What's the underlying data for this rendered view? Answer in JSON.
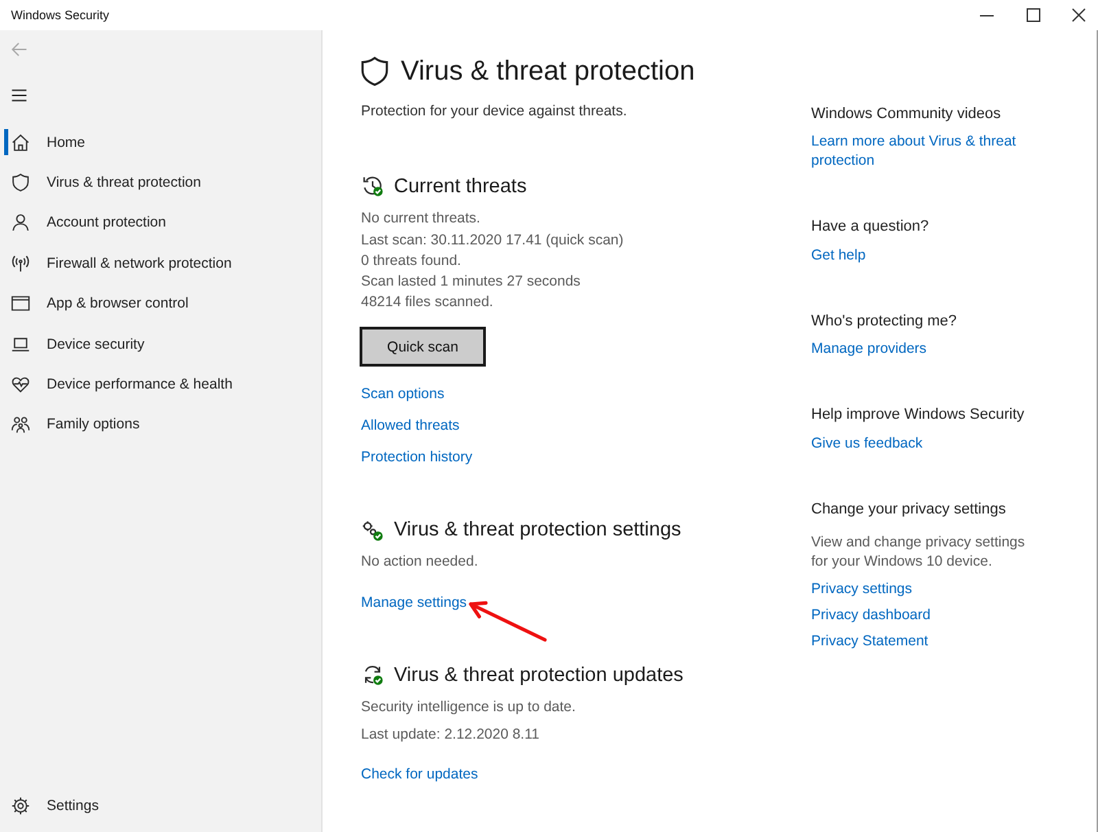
{
  "window": {
    "title": "Windows Security"
  },
  "sidebar": {
    "back_button": {
      "disabled": true
    },
    "items": [
      {
        "label": "Home",
        "selected": true
      },
      {
        "label": "Virus & threat protection",
        "selected": false
      },
      {
        "label": "Account protection",
        "selected": false
      },
      {
        "label": "Firewall & network protection",
        "selected": false
      },
      {
        "label": "App & browser control",
        "selected": false
      },
      {
        "label": "Device security",
        "selected": false
      },
      {
        "label": "Device performance & health",
        "selected": false
      },
      {
        "label": "Family options",
        "selected": false
      }
    ],
    "settings": {
      "label": "Settings"
    }
  },
  "page": {
    "title": "Virus & threat protection",
    "subtitle": "Protection for your device against threats."
  },
  "sections": [
    {
      "kind": "threats",
      "title": "Current threats",
      "status": "No current threats.",
      "details": [
        "Last scan: 30.11.2020 17.41 (quick scan)",
        "0 threats found.",
        "Scan lasted 1 minutes 27 seconds",
        "48214 files scanned."
      ],
      "button": "Quick scan",
      "links": [
        "Scan options",
        "Allowed threats",
        "Protection history"
      ]
    },
    {
      "kind": "settings",
      "title": "Virus & threat protection settings",
      "status": "No action needed.",
      "links": [
        "Manage settings"
      ]
    },
    {
      "kind": "updates",
      "title": "Virus & threat protection updates",
      "status": "Security intelligence is up to date.",
      "details": [
        "Last update: 2.12.2020 8.11"
      ],
      "links": [
        "Check for updates"
      ]
    }
  ],
  "aside": [
    {
      "title": "Windows Community videos",
      "links": [
        "Learn more about Virus & threat protection"
      ]
    },
    {
      "title": "Have a question?",
      "links": [
        "Get help"
      ]
    },
    {
      "title": "Who's protecting me?",
      "links": [
        "Manage providers"
      ]
    },
    {
      "title": "Help improve Windows Security",
      "links": [
        "Give us feedback"
      ]
    },
    {
      "title": "Change your privacy settings",
      "text": "View and change privacy settings for your Windows 10 device.",
      "links": [
        "Privacy settings",
        "Privacy dashboard",
        "Privacy Statement"
      ]
    }
  ]
}
